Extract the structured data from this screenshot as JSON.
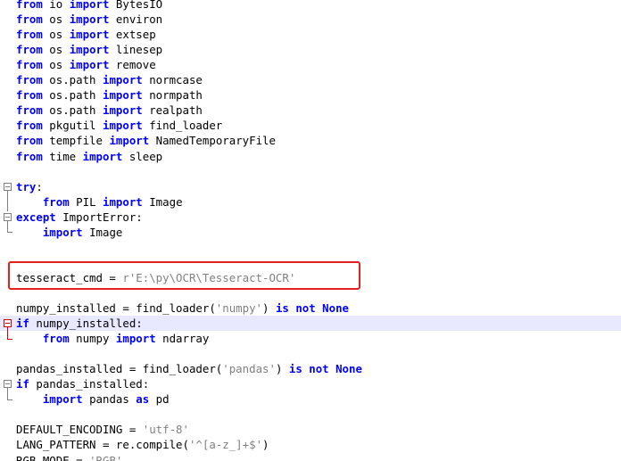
{
  "editor": {
    "lines": [
      [
        {
          "t": "from",
          "k": "kw"
        },
        {
          "t": " io "
        },
        {
          "t": "import",
          "k": "kw"
        },
        {
          "t": " BytesIO"
        }
      ],
      [
        {
          "t": "from",
          "k": "kw"
        },
        {
          "t": " os "
        },
        {
          "t": "import",
          "k": "kw"
        },
        {
          "t": " environ"
        }
      ],
      [
        {
          "t": "from",
          "k": "kw"
        },
        {
          "t": " os "
        },
        {
          "t": "import",
          "k": "kw"
        },
        {
          "t": " extsep"
        }
      ],
      [
        {
          "t": "from",
          "k": "kw"
        },
        {
          "t": " os "
        },
        {
          "t": "import",
          "k": "kw"
        },
        {
          "t": " linesep"
        }
      ],
      [
        {
          "t": "from",
          "k": "kw"
        },
        {
          "t": " os "
        },
        {
          "t": "import",
          "k": "kw"
        },
        {
          "t": " remove"
        }
      ],
      [
        {
          "t": "from",
          "k": "kw"
        },
        {
          "t": " os.path "
        },
        {
          "t": "import",
          "k": "kw"
        },
        {
          "t": " normcase"
        }
      ],
      [
        {
          "t": "from",
          "k": "kw"
        },
        {
          "t": " os.path "
        },
        {
          "t": "import",
          "k": "kw"
        },
        {
          "t": " normpath"
        }
      ],
      [
        {
          "t": "from",
          "k": "kw"
        },
        {
          "t": " os.path "
        },
        {
          "t": "import",
          "k": "kw"
        },
        {
          "t": " realpath"
        }
      ],
      [
        {
          "t": "from",
          "k": "kw"
        },
        {
          "t": " pkgutil "
        },
        {
          "t": "import",
          "k": "kw"
        },
        {
          "t": " find_loader"
        }
      ],
      [
        {
          "t": "from",
          "k": "kw"
        },
        {
          "t": " tempfile "
        },
        {
          "t": "import",
          "k": "kw"
        },
        {
          "t": " NamedTemporaryFile"
        }
      ],
      [
        {
          "t": "from",
          "k": "kw"
        },
        {
          "t": " time "
        },
        {
          "t": "import",
          "k": "kw"
        },
        {
          "t": " sleep"
        }
      ],
      [],
      [
        {
          "t": "try",
          "k": "kw"
        },
        {
          "t": ":"
        }
      ],
      [
        {
          "t": "    "
        },
        {
          "t": "from",
          "k": "kw"
        },
        {
          "t": " PIL "
        },
        {
          "t": "import",
          "k": "kw"
        },
        {
          "t": " Image"
        }
      ],
      [
        {
          "t": "except",
          "k": "kw"
        },
        {
          "t": " ImportError:"
        }
      ],
      [
        {
          "t": "    "
        },
        {
          "t": "import",
          "k": "kw"
        },
        {
          "t": " Image"
        }
      ],
      [],
      [],
      [
        {
          "t": "tesseract_cmd = "
        },
        {
          "t": "r'E:\\py\\OCR\\Tesseract-OCR'",
          "k": "str"
        }
      ],
      [],
      [
        {
          "t": "numpy_installed = find_loader("
        },
        {
          "t": "'numpy'",
          "k": "str"
        },
        {
          "t": ") "
        },
        {
          "t": "is not None",
          "k": "kw"
        }
      ],
      [
        {
          "t": "if",
          "k": "kw"
        },
        {
          "t": " numpy_installed:"
        }
      ],
      [
        {
          "t": "    "
        },
        {
          "t": "from",
          "k": "kw"
        },
        {
          "t": " numpy "
        },
        {
          "t": "import",
          "k": "kw"
        },
        {
          "t": " ndarray"
        }
      ],
      [],
      [
        {
          "t": "pandas_installed = find_loader("
        },
        {
          "t": "'pandas'",
          "k": "str"
        },
        {
          "t": ") "
        },
        {
          "t": "is not None",
          "k": "kw"
        }
      ],
      [
        {
          "t": "if",
          "k": "kw"
        },
        {
          "t": " pandas_installed:"
        }
      ],
      [
        {
          "t": "    "
        },
        {
          "t": "import",
          "k": "kw"
        },
        {
          "t": " pandas "
        },
        {
          "t": "as",
          "k": "kw"
        },
        {
          "t": " pd"
        }
      ],
      [],
      [
        {
          "t": "DEFAULT_ENCODING = "
        },
        {
          "t": "'utf-8'",
          "k": "str"
        }
      ],
      [
        {
          "t": "LANG_PATTERN = re.compile("
        },
        {
          "t": "'^[a-z_]+$'",
          "k": "str"
        },
        {
          "t": ")"
        }
      ],
      [
        {
          "t": "RGB_MODE = "
        },
        {
          "t": "'RGB'",
          "k": "str"
        }
      ]
    ],
    "current_line_index": 21
  },
  "colors": {
    "keyword": "#0000ff",
    "string": "#808080",
    "current_line_bg": "#e8e8ff",
    "annotation_box": "#e3201b"
  }
}
